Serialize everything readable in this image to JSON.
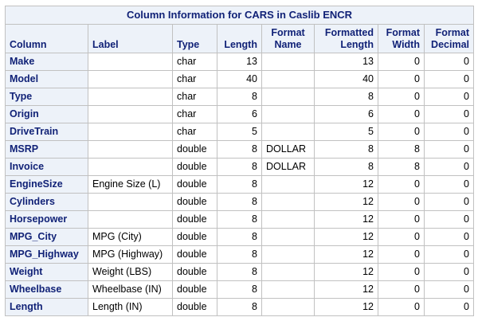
{
  "table": {
    "title": "Column Information for CARS in Caslib ENCR",
    "headers": {
      "column": "Column",
      "label": "Label",
      "type": "Type",
      "length": "Length",
      "format_name": [
        "Format",
        "Name"
      ],
      "formatted_length": [
        "Formatted",
        "Length"
      ],
      "format_width": [
        "Format",
        "Width"
      ],
      "format_decimal": [
        "Format",
        "Decimal"
      ]
    },
    "rows": [
      {
        "column": "Make",
        "label": "",
        "type": "char",
        "length": "13",
        "format_name": "",
        "formatted_length": "13",
        "format_width": "0",
        "format_decimal": "0"
      },
      {
        "column": "Model",
        "label": "",
        "type": "char",
        "length": "40",
        "format_name": "",
        "formatted_length": "40",
        "format_width": "0",
        "format_decimal": "0"
      },
      {
        "column": "Type",
        "label": "",
        "type": "char",
        "length": "8",
        "format_name": "",
        "formatted_length": "8",
        "format_width": "0",
        "format_decimal": "0"
      },
      {
        "column": "Origin",
        "label": "",
        "type": "char",
        "length": "6",
        "format_name": "",
        "formatted_length": "6",
        "format_width": "0",
        "format_decimal": "0"
      },
      {
        "column": "DriveTrain",
        "label": "",
        "type": "char",
        "length": "5",
        "format_name": "",
        "formatted_length": "5",
        "format_width": "0",
        "format_decimal": "0"
      },
      {
        "column": "MSRP",
        "label": "",
        "type": "double",
        "length": "8",
        "format_name": "DOLLAR",
        "formatted_length": "8",
        "format_width": "8",
        "format_decimal": "0"
      },
      {
        "column": "Invoice",
        "label": "",
        "type": "double",
        "length": "8",
        "format_name": "DOLLAR",
        "formatted_length": "8",
        "format_width": "8",
        "format_decimal": "0"
      },
      {
        "column": "EngineSize",
        "label": "Engine Size (L)",
        "type": "double",
        "length": "8",
        "format_name": "",
        "formatted_length": "12",
        "format_width": "0",
        "format_decimal": "0"
      },
      {
        "column": "Cylinders",
        "label": "",
        "type": "double",
        "length": "8",
        "format_name": "",
        "formatted_length": "12",
        "format_width": "0",
        "format_decimal": "0"
      },
      {
        "column": "Horsepower",
        "label": "",
        "type": "double",
        "length": "8",
        "format_name": "",
        "formatted_length": "12",
        "format_width": "0",
        "format_decimal": "0"
      },
      {
        "column": "MPG_City",
        "label": "MPG (City)",
        "type": "double",
        "length": "8",
        "format_name": "",
        "formatted_length": "12",
        "format_width": "0",
        "format_decimal": "0"
      },
      {
        "column": "MPG_Highway",
        "label": "MPG (Highway)",
        "type": "double",
        "length": "8",
        "format_name": "",
        "formatted_length": "12",
        "format_width": "0",
        "format_decimal": "0"
      },
      {
        "column": "Weight",
        "label": "Weight (LBS)",
        "type": "double",
        "length": "8",
        "format_name": "",
        "formatted_length": "12",
        "format_width": "0",
        "format_decimal": "0"
      },
      {
        "column": "Wheelbase",
        "label": "Wheelbase (IN)",
        "type": "double",
        "length": "8",
        "format_name": "",
        "formatted_length": "12",
        "format_width": "0",
        "format_decimal": "0"
      },
      {
        "column": "Length",
        "label": "Length (IN)",
        "type": "double",
        "length": "8",
        "format_name": "",
        "formatted_length": "12",
        "format_width": "0",
        "format_decimal": "0"
      }
    ]
  },
  "colors": {
    "header_background": "#edf2f9",
    "header_text": "#112277",
    "grid_lines": "#c1c1c1"
  }
}
